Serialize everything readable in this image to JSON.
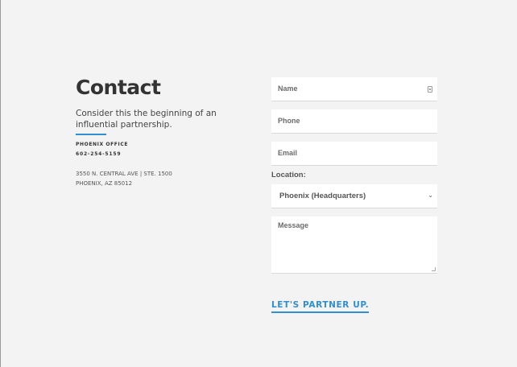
{
  "header": {
    "title": "Contact"
  },
  "intro": {
    "tagline": "Consider this the beginning of an influential partnership."
  },
  "office": {
    "label": "PHOENIX OFFICE",
    "phone": "602-254-5159",
    "address_line1": "3550 N. CENTRAL AVE | STE. 1500",
    "address_line2": "PHOENIX, AZ 85012"
  },
  "form": {
    "name_placeholder": "Name",
    "phone_placeholder": "Phone",
    "email_placeholder": "Email",
    "location_label": "Location:",
    "location_selected": "Phoenix (Headquarters)",
    "message_placeholder": "Message",
    "submit_label": "LET'S PARTNER UP."
  },
  "colors": {
    "accent": "#2f8fd0",
    "background": "#f3f3f3"
  }
}
